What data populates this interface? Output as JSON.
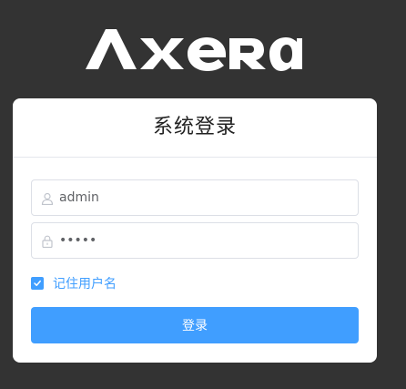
{
  "brand": {
    "logo_text": "AXERA",
    "logo_icon": "axera-logo"
  },
  "login": {
    "title": "系统登录",
    "username": {
      "value": "admin",
      "icon": "user-icon"
    },
    "password": {
      "value": "admin",
      "icon": "lock-icon"
    },
    "remember": {
      "label": "记住用户名",
      "checked": true
    },
    "submit_label": "登录"
  },
  "colors": {
    "background": "#333333",
    "card": "#ffffff",
    "accent": "#409eff",
    "logo": "#ffffff"
  }
}
